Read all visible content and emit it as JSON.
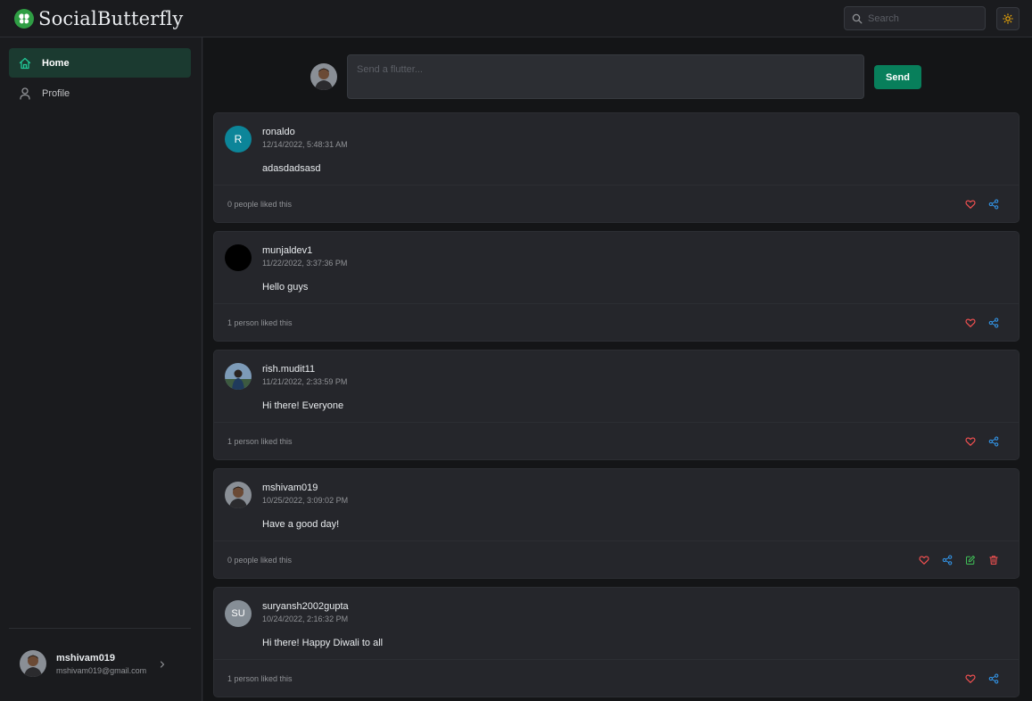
{
  "header": {
    "brand_name": "SocialButterfly",
    "search_placeholder": "Search"
  },
  "sidebar": {
    "items": [
      {
        "label": "Home",
        "icon": "home-icon",
        "active": true
      },
      {
        "label": "Profile",
        "icon": "user-icon",
        "active": false
      }
    ],
    "user": {
      "name": "mshivam019",
      "email": "mshivam019@gmail.com"
    }
  },
  "composer": {
    "placeholder": "Send a flutter...",
    "send_label": "Send"
  },
  "posts": [
    {
      "username": "ronaldo",
      "timestamp": "12/14/2022, 5:48:31 AM",
      "text": "adasdadsasd",
      "likes": "0 people liked this",
      "avatar_initials": "R",
      "avatar_color": "#0c8599",
      "own": false
    },
    {
      "username": "munjaldev1",
      "timestamp": "11/22/2022, 3:37:36 PM",
      "text": "Hello guys",
      "likes": "1 person liked this",
      "avatar_initials": "",
      "avatar_color": "#000000",
      "own": false
    },
    {
      "username": "rish.mudit11",
      "timestamp": "11/21/2022, 2:33:59 PM",
      "text": "Hi there! Everyone",
      "likes": "1 person liked this",
      "avatar_initials": "",
      "avatar_color": "#4a6a8a",
      "own": false
    },
    {
      "username": "mshivam019",
      "timestamp": "10/25/2022, 3:09:02 PM",
      "text": "Have a good day!",
      "likes": "0 people liked this",
      "avatar_initials": "",
      "avatar_color": "#6b5a4a",
      "own": true
    },
    {
      "username": "suryansh2002gupta",
      "timestamp": "10/24/2022, 2:16:32 PM",
      "text": "Hi there! Happy Diwali to all",
      "likes": "1 person liked this",
      "avatar_initials": "SU",
      "avatar_color": "#868e96",
      "own": false
    }
  ],
  "colors": {
    "accent": "#087f5b",
    "like": "#fa5252",
    "share": "#339af0",
    "edit": "#40c057",
    "delete": "#fa5252"
  }
}
